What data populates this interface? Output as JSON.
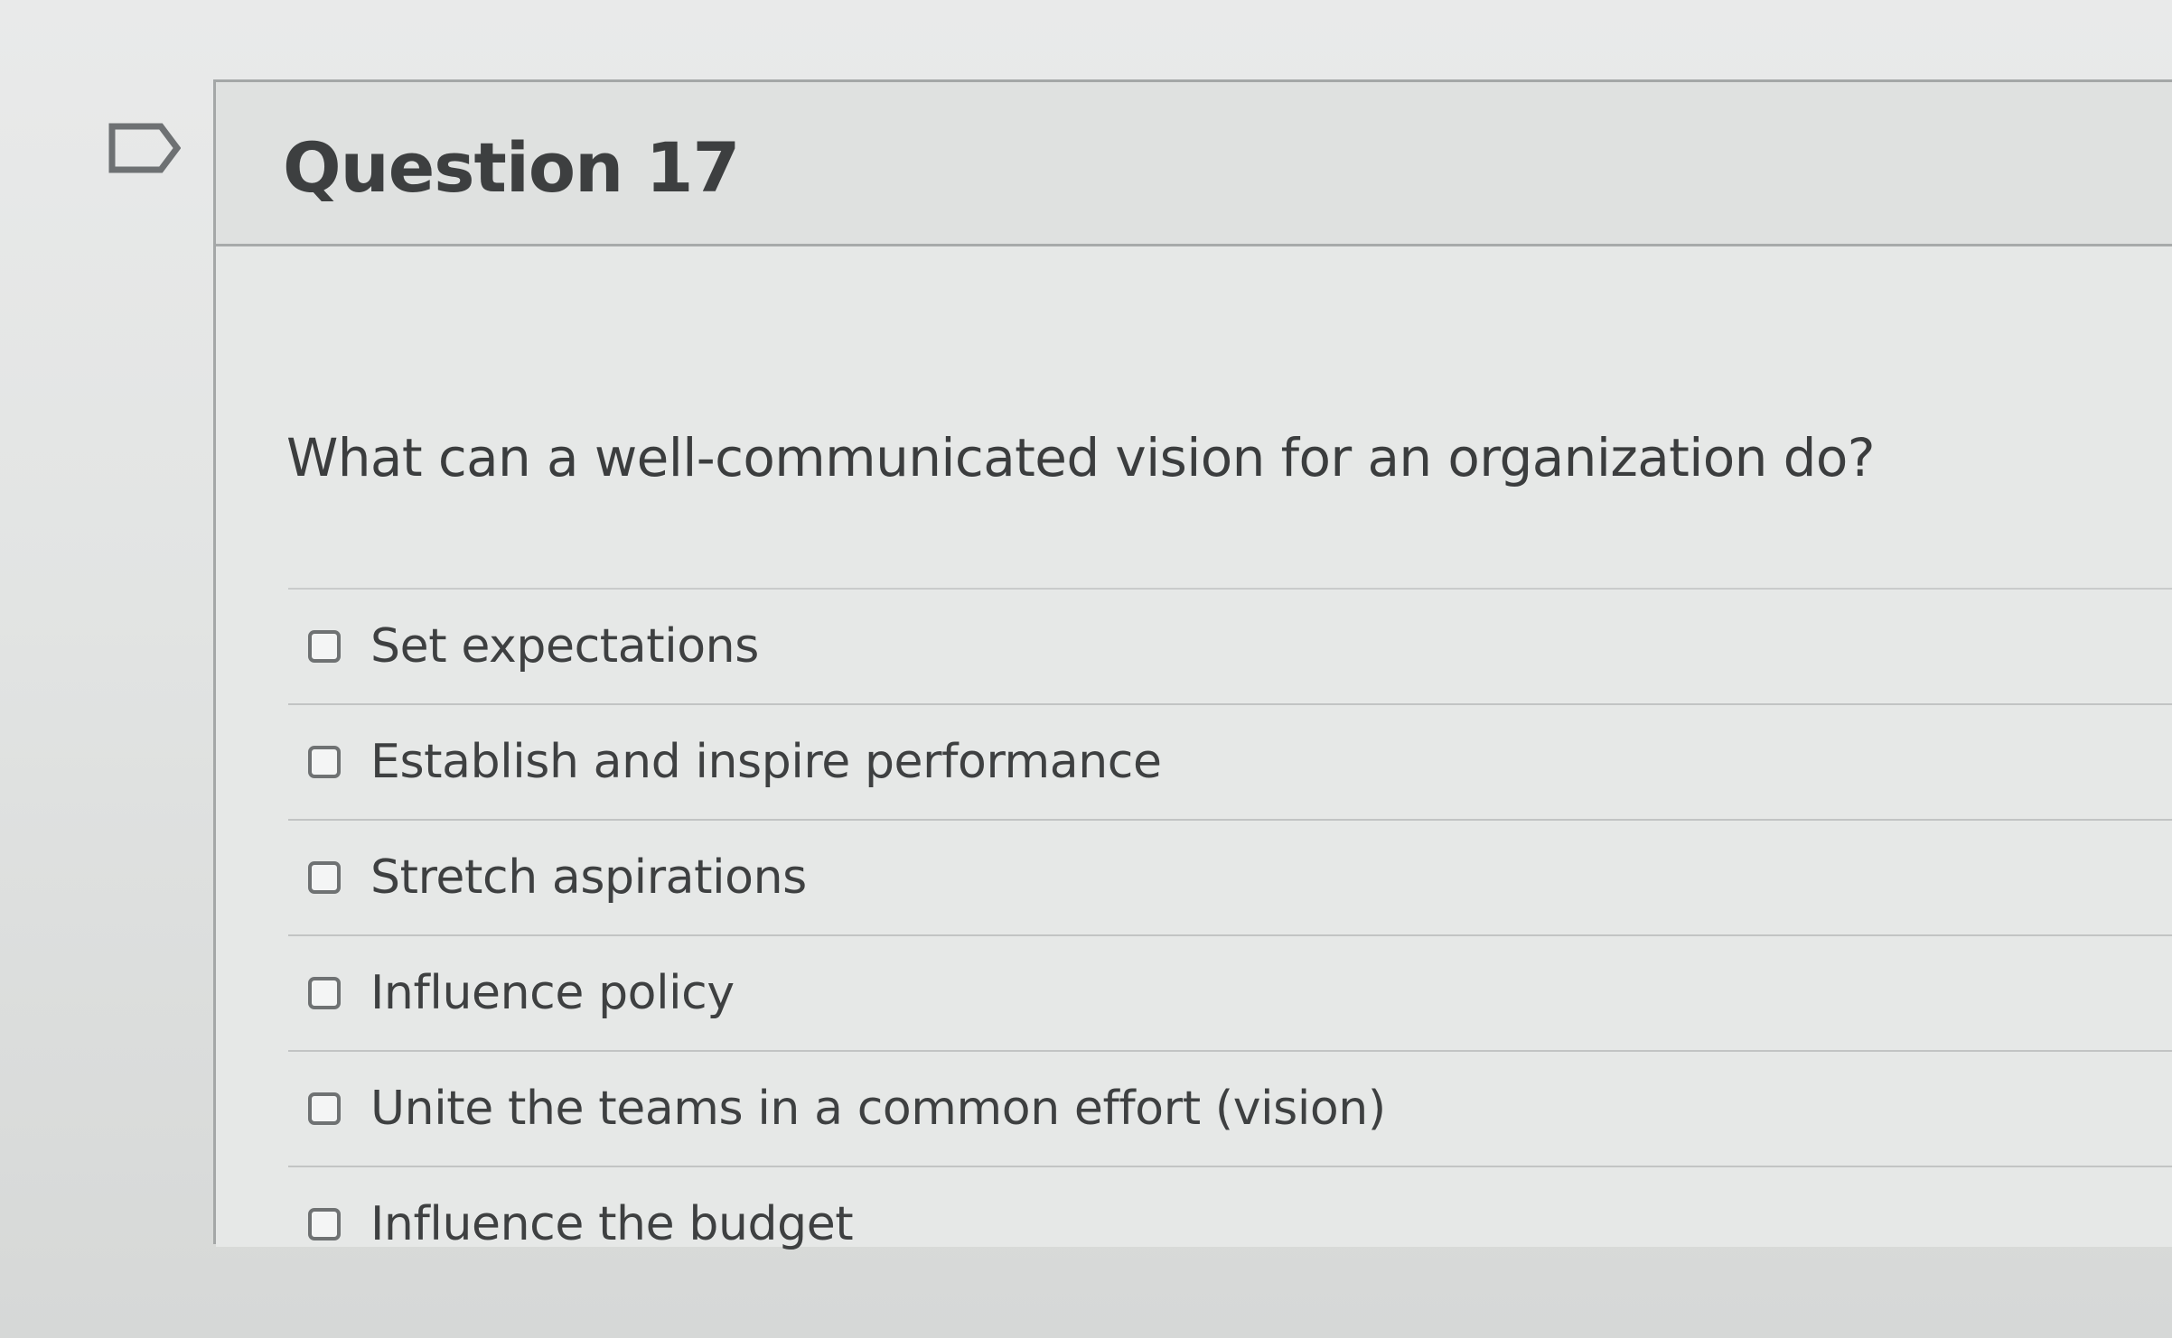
{
  "question": {
    "flag_icon": "flag-outline-icon",
    "title": "Question 17",
    "text": "What can a well-communicated vision for an organization do?",
    "answers": [
      {
        "label": "Set expectations"
      },
      {
        "label": "Establish and inspire performance"
      },
      {
        "label": "Stretch aspirations"
      },
      {
        "label": "Influence policy"
      },
      {
        "label": "Unite the teams in a common effort (vision)"
      },
      {
        "label": "Influence the budget"
      }
    ]
  }
}
